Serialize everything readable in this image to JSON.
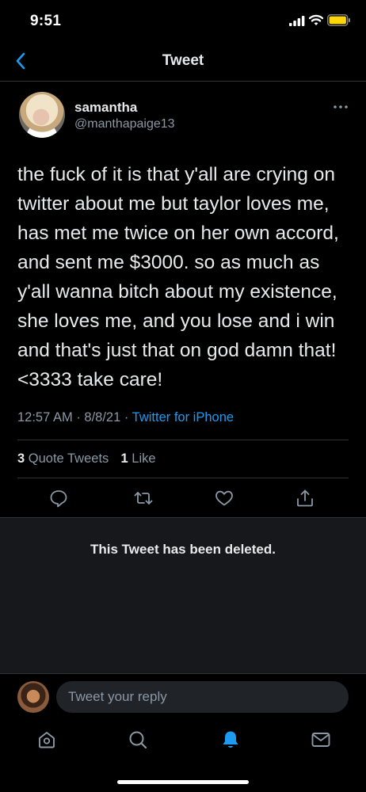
{
  "status_bar": {
    "time": "9:51"
  },
  "header": {
    "title": "Tweet"
  },
  "tweet": {
    "display_name": "samantha",
    "handle": "@manthapaige13",
    "text": "the fuck of it is that y'all are crying on twitter about me but taylor loves me, has met me twice on her own accord, and sent me $3000. so as much as y'all wanna bitch about my existence, she loves me, and you lose and i win and that's just that on god damn that! <3333 take care!",
    "time": "12:57 AM",
    "date": "8/8/21",
    "source": "Twitter for iPhone",
    "quote_count": "3",
    "quote_label": "Quote Tweets",
    "like_count": "1",
    "like_label": "Like"
  },
  "quoted": {
    "deleted_message": "This Tweet has been deleted."
  },
  "reply": {
    "placeholder": "Tweet your reply"
  },
  "colors": {
    "accent": "#1d9bf0",
    "background": "#000000",
    "panel": "#16181c",
    "battery": "#ffd60a"
  },
  "icons": {
    "status": [
      "signal-icon",
      "wifi-icon",
      "battery-icon"
    ],
    "actions": [
      "reply-icon",
      "retweet-icon",
      "like-icon",
      "share-icon"
    ],
    "tabs": [
      "home-icon",
      "search-icon",
      "notifications-icon",
      "messages-icon"
    ]
  }
}
